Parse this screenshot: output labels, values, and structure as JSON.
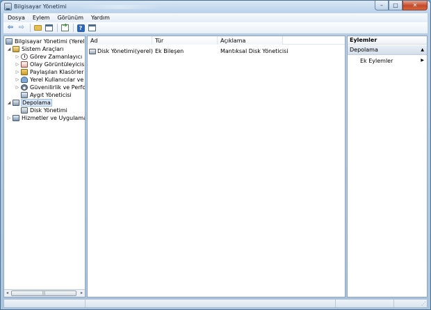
{
  "window": {
    "title": "Bilgisayar Yönetimi"
  },
  "caption_buttons": {
    "minimize": "–",
    "maximize": "□",
    "close": "✕"
  },
  "menu": [
    "Dosya",
    "Eylem",
    "Görünüm",
    "Yardım"
  ],
  "toolbar": {
    "icons": [
      "back-arrow-icon",
      "forward-arrow-icon",
      "up-folder-icon",
      "show-hide-tree-icon",
      "export-list-icon",
      "help-icon",
      "show-hide-action-pane-icon"
    ],
    "back": "⇦",
    "forward": "⇨",
    "help": "?"
  },
  "tree": {
    "root": "Bilgisayar Yönetimi (Yerel)",
    "system_tools": "Sistem Araçları",
    "task_scheduler": "Görev Zamanlayıcı",
    "event_viewer": "Olay Görüntüleyicisi",
    "shared_folders": "Paylaşılan Klasörler",
    "local_users": "Yerel Kullanıcılar ve Gru",
    "performance": "Güvenilirlik ve Performa",
    "device_manager": "Aygıt Yöneticisi",
    "storage": "Depolama",
    "disk_management": "Disk Yönetimi",
    "services_apps": "Hizmetler ve Uygulamalar",
    "expanded_glyph": "◢",
    "collapsed_glyph": "▷",
    "scroll_left": "◂",
    "scroll_right": "▸",
    "scroll_grip": "|||"
  },
  "list": {
    "columns": [
      "Ad",
      "Tür",
      "Açıklama"
    ],
    "rows": [
      {
        "name": "Disk Yönetimi(yerel)",
        "type": "Ek Bileşen",
        "description": "Mantıksal Disk Yöneticisi"
      }
    ]
  },
  "actions": {
    "title": "Eylemler",
    "section": "Depolama",
    "section_caret": "▲",
    "more_actions": "Ek Eylemler",
    "more_arrow": "▶"
  },
  "statusbar": {
    "grip": "⋰"
  }
}
